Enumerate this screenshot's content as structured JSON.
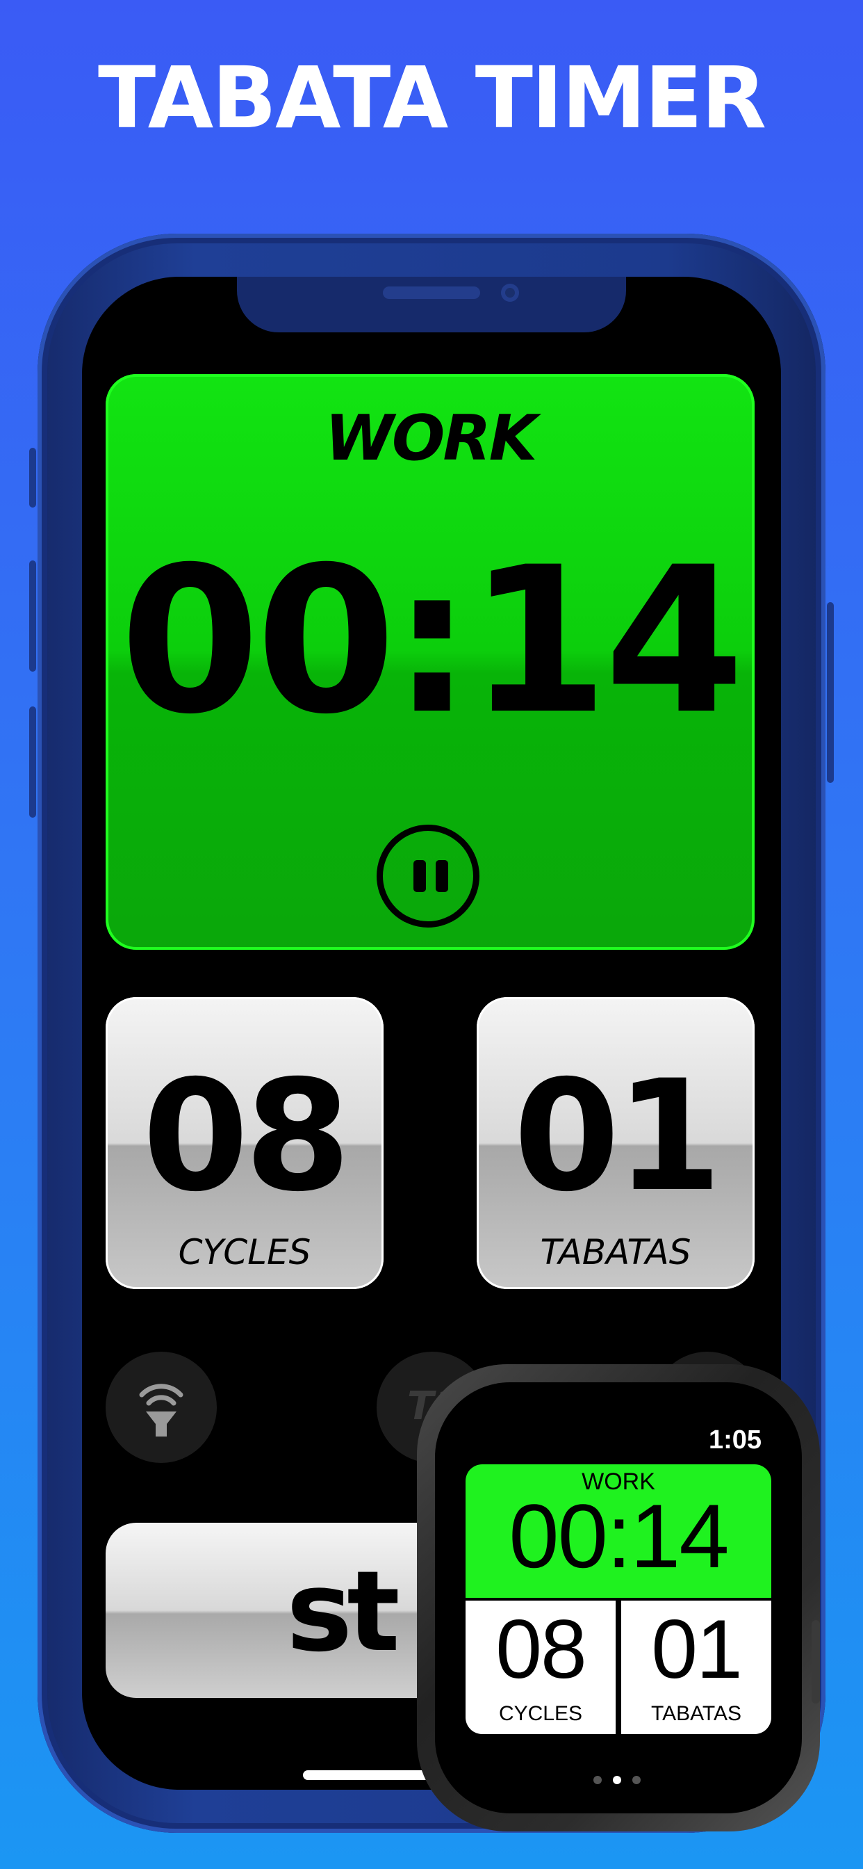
{
  "headline": "TABATA TIMER",
  "phone": {
    "phase_label": "WORK",
    "timer": "00:14",
    "cycles": {
      "value": "08",
      "label": "CYCLES"
    },
    "tabatas": {
      "value": "01",
      "label": "TABATAS"
    },
    "t10_label": "T1",
    "stop_label": "st"
  },
  "watch": {
    "clock": "1:05",
    "phase_label": "WORK",
    "timer": "00:14",
    "cycles": {
      "value": "08",
      "label": "CYCLES"
    },
    "tabatas": {
      "value": "01",
      "label": "TABATAS"
    },
    "page_indicator": {
      "pages": 3,
      "current": 2
    }
  },
  "colors": {
    "work_green": "#0cce0c",
    "watch_green": "#1ff21f",
    "background_top": "#3a5bf5",
    "background_bottom": "#1b96f3"
  },
  "icons": [
    "pause-icon",
    "sound-horn-icon",
    "t10-icon"
  ]
}
